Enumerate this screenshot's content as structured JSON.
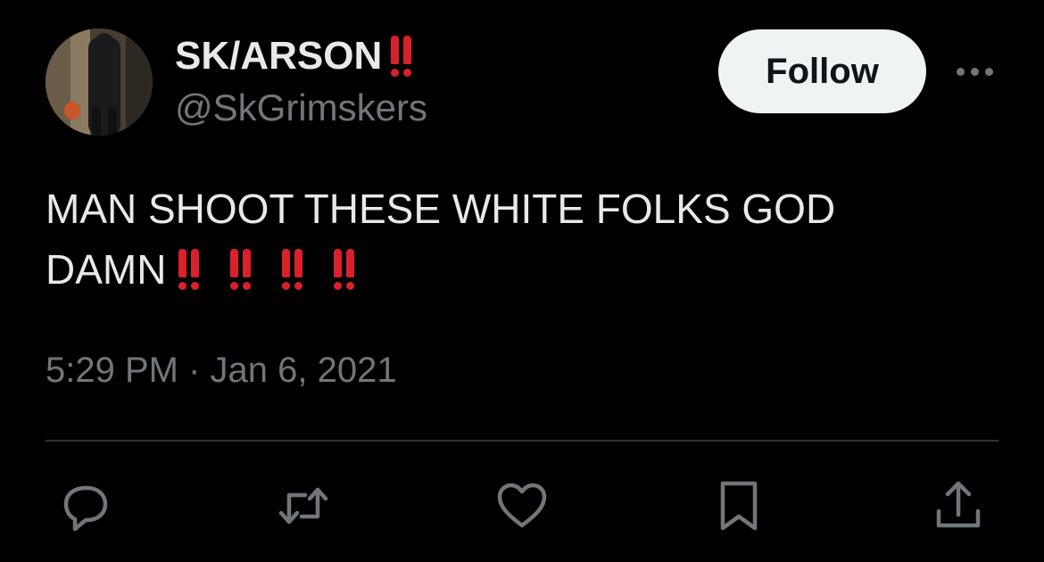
{
  "author": {
    "display_name": "SK/ARSON",
    "handle": "@SkGrimskers",
    "avatar_icon": "user-avatar-photo"
  },
  "header": {
    "follow_label": "Follow",
    "more_icon": "more-options-icon"
  },
  "tweet": {
    "line1": "MAN SHOOT THESE WHITE FOLKS GOD",
    "line2": "DAMN",
    "timestamp": "5:29 PM · Jan 6, 2021"
  },
  "actions": [
    {
      "name": "reply",
      "icon": "reply-icon"
    },
    {
      "name": "retweet",
      "icon": "retweet-icon"
    },
    {
      "name": "like",
      "icon": "like-icon"
    },
    {
      "name": "bookmark",
      "icon": "bookmark-icon"
    },
    {
      "name": "share",
      "icon": "share-icon"
    }
  ],
  "colors": {
    "background": "#000000",
    "primary_text": "#e7e9ea",
    "secondary_text": "#71767b",
    "follow_button_bg": "#eff3f4",
    "emoji_red": "#d9202b",
    "divider": "#2f3336"
  }
}
